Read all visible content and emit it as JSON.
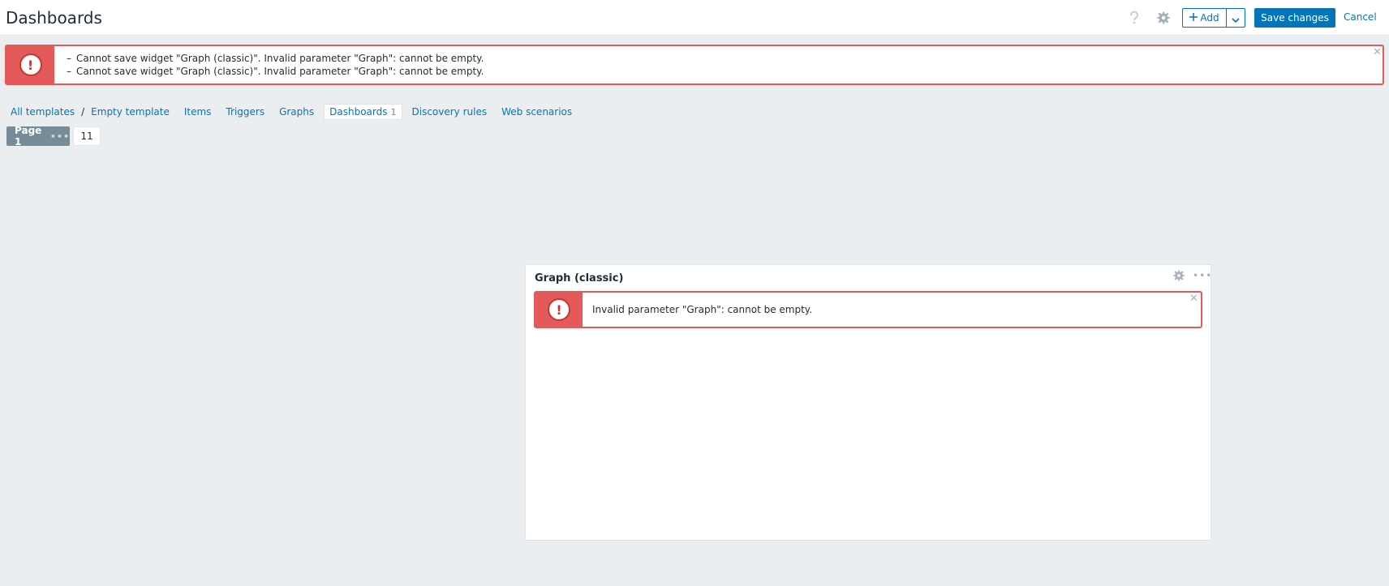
{
  "header": {
    "title": "Dashboards",
    "help_icon": "question-icon",
    "settings_icon": "gear-icon",
    "add_label": "Add",
    "save_label": "Save changes",
    "cancel_label": "Cancel"
  },
  "global_message": {
    "lines": [
      "Cannot save widget \"Graph (classic)\". Invalid parameter \"Graph\": cannot be empty.",
      "Cannot save widget \"Graph (classic)\". Invalid parameter \"Graph\": cannot be empty."
    ],
    "dash": "–",
    "close": "✕"
  },
  "nav": {
    "all_templates": "All templates",
    "separator": "/",
    "template": "Empty template",
    "items": "Items",
    "triggers": "Triggers",
    "graphs": "Graphs",
    "dashboards": "Dashboards",
    "dashboards_count": "1",
    "discovery_rules": "Discovery rules",
    "web_scenarios": "Web scenarios"
  },
  "pages": {
    "active": "Page 1",
    "dots": "•••",
    "other": "11"
  },
  "widget": {
    "title": "Graph (classic)",
    "more": "•••",
    "message": "Invalid parameter \"Graph\": cannot be empty.",
    "close": "✕"
  },
  "colors": {
    "accent": "#0275b8",
    "error": "#e45959",
    "background": "#ebeef0"
  }
}
